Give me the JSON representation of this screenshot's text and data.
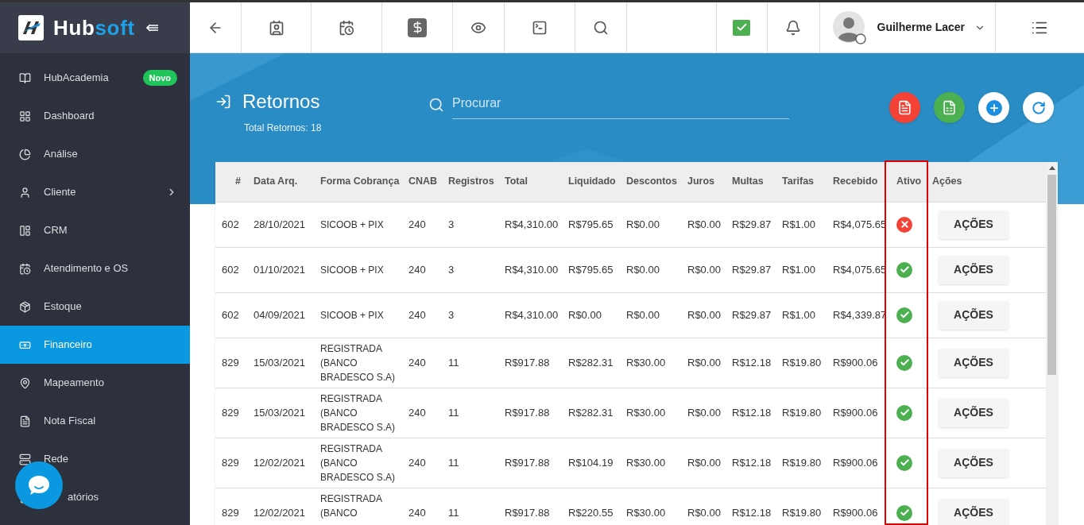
{
  "logo": {
    "part1": "Hub",
    "part2": "soft"
  },
  "user": {
    "name": "Guilherme Lacer"
  },
  "sidebar": {
    "items": [
      {
        "label": "HubAcademia",
        "badge": "Novo",
        "has_submenu": false,
        "selected": false
      },
      {
        "label": "Dashboard",
        "has_submenu": false,
        "selected": false
      },
      {
        "label": "Análise",
        "has_submenu": false,
        "selected": false
      },
      {
        "label": "Cliente",
        "has_submenu": true,
        "selected": false
      },
      {
        "label": "CRM",
        "has_submenu": false,
        "selected": false
      },
      {
        "label": "Atendimento e OS",
        "has_submenu": false,
        "selected": false
      },
      {
        "label": "Estoque",
        "has_submenu": false,
        "selected": false
      },
      {
        "label": "Financeiro",
        "has_submenu": false,
        "selected": true
      },
      {
        "label": "Mapeamento",
        "has_submenu": false,
        "selected": false
      },
      {
        "label": "Nota Fiscal",
        "has_submenu": false,
        "selected": false
      },
      {
        "label": "Rede",
        "has_submenu": false,
        "selected": false
      },
      {
        "label": "atórios",
        "has_submenu": false,
        "selected": false
      }
    ]
  },
  "page": {
    "title": "Retornos",
    "subtitle": "Total Retornos: 18"
  },
  "search": {
    "placeholder": "Procurar"
  },
  "table": {
    "columns": [
      "#",
      "Data Arq.",
      "Forma Cobrança",
      "CNAB",
      "Registros",
      "Total",
      "Liquidado",
      "Descontos",
      "Juros",
      "Multas",
      "Tarifas",
      "Recebido",
      "Ativo",
      "Ações"
    ],
    "rows": [
      {
        "cells": [
          "602",
          "28/10/2021",
          "SICOOB + PIX",
          "240",
          "3",
          "R$4,310.00",
          "R$795.65",
          "R$0.00",
          "R$0.00",
          "R$29.87",
          "R$1.00",
          "R$4,075.65"
        ],
        "active": false,
        "action": "AÇÕES"
      },
      {
        "cells": [
          "602",
          "01/10/2021",
          "SICOOB + PIX",
          "240",
          "3",
          "R$4,310.00",
          "R$795.65",
          "R$0.00",
          "R$0.00",
          "R$29.87",
          "R$1.00",
          "R$4,075.65"
        ],
        "active": true,
        "action": "AÇÕES"
      },
      {
        "cells": [
          "602",
          "04/09/2021",
          "SICOOB + PIX",
          "240",
          "3",
          "R$4,310.00",
          "R$0.00",
          "R$0.00",
          "R$0.00",
          "R$29.87",
          "R$1.00",
          "R$4,339.87"
        ],
        "active": true,
        "action": "AÇÕES"
      },
      {
        "cells": [
          "829",
          "15/03/2021",
          "REGISTRADA (BANCO BRADESCO S.A)",
          "240",
          "11",
          "R$917.88",
          "R$282.31",
          "R$30.00",
          "R$0.00",
          "R$12.18",
          "R$19.80",
          "R$900.06"
        ],
        "active": true,
        "action": "AÇÕES"
      },
      {
        "cells": [
          "829",
          "15/03/2021",
          "REGISTRADA (BANCO BRADESCO S.A)",
          "240",
          "11",
          "R$917.88",
          "R$282.31",
          "R$30.00",
          "R$0.00",
          "R$12.18",
          "R$19.80",
          "R$900.06"
        ],
        "active": true,
        "action": "AÇÕES"
      },
      {
        "cells": [
          "829",
          "12/02/2021",
          "REGISTRADA (BANCO BRADESCO S.A)",
          "240",
          "11",
          "R$917.88",
          "R$104.19",
          "R$30.00",
          "R$0.00",
          "R$12.18",
          "R$19.80",
          "R$900.06"
        ],
        "active": true,
        "action": "AÇÕES"
      },
      {
        "cells": [
          "829",
          "12/02/2021",
          "REGISTRADA (BANCO",
          "240",
          "11",
          "R$917.88",
          "R$220.55",
          "R$30.00",
          "R$0.00",
          "R$12.18",
          "R$19.80",
          "R$900.06"
        ],
        "active": true,
        "action": "AÇÕES"
      }
    ]
  }
}
